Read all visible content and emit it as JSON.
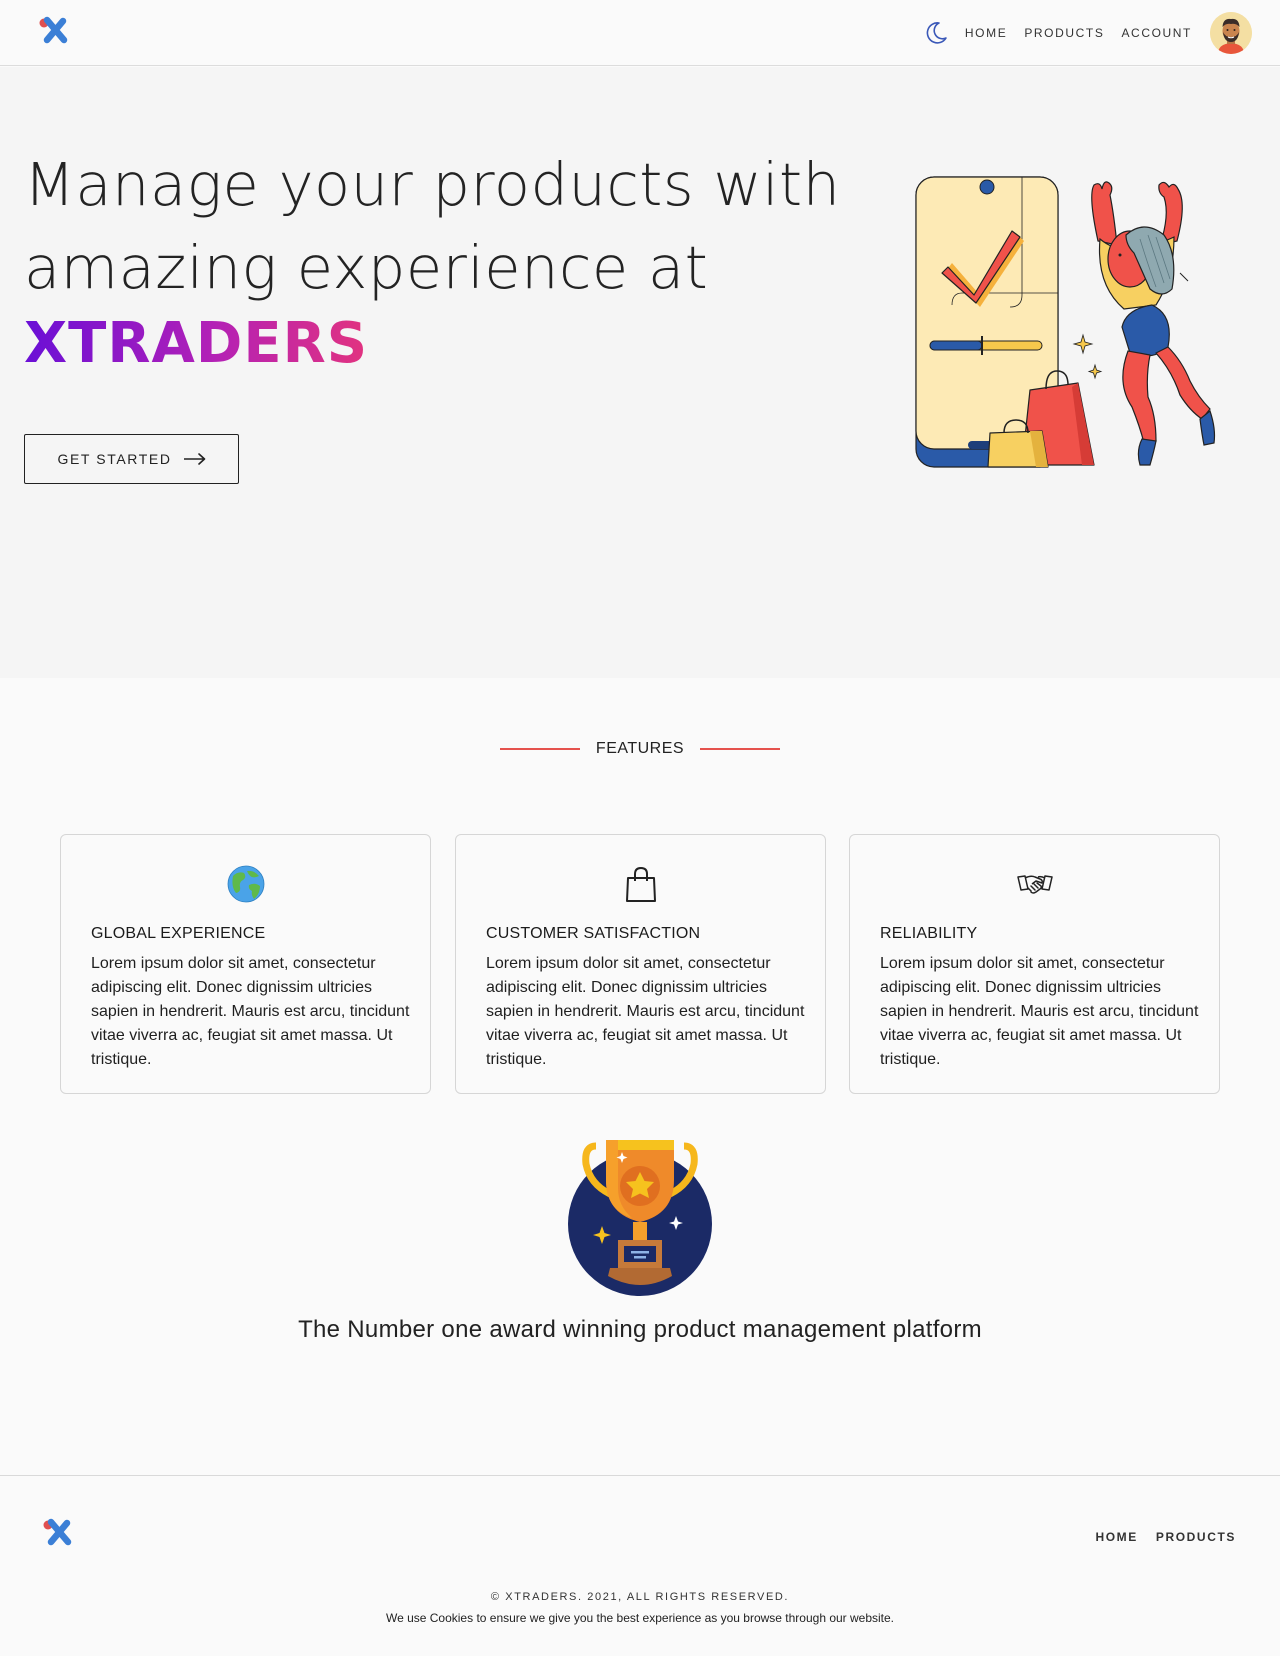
{
  "header": {
    "nav": {
      "home": "HOME",
      "products": "PRODUCTS",
      "account": "ACCOUNT"
    },
    "icons": [
      "logo-icon",
      "moon-icon",
      "avatar"
    ]
  },
  "hero": {
    "line1": "Manage your products with",
    "line2": "amazing experience at",
    "brand": "XTRADERS",
    "cta_label": "GET STARTED"
  },
  "features": {
    "heading": "FEATURES",
    "cards": [
      {
        "icon": "globe-icon",
        "title": "GLOBAL EXPERIENCE",
        "body": "Lorem ipsum dolor sit amet, consectetur adipiscing elit. Donec dignissim ultricies sapien in hendrerit. Mauris est arcu, tincidunt vitae viverra ac, feugiat sit amet massa. Ut tristique."
      },
      {
        "icon": "shopping-bag-icon",
        "title": "CUSTOMER SATISFACTION",
        "body": "Lorem ipsum dolor sit amet, consectetur adipiscing elit. Donec dignissim ultricies sapien in hendrerit. Mauris est arcu, tincidunt vitae viverra ac, feugiat sit amet massa. Ut tristique."
      },
      {
        "icon": "handshake-icon",
        "title": "RELIABILITY",
        "body": "Lorem ipsum dolor sit amet, consectetur adipiscing elit. Donec dignissim ultricies sapien in hendrerit. Mauris est arcu, tincidunt vitae viverra ac, feugiat sit amet massa. Ut tristique."
      }
    ]
  },
  "award": {
    "icon": "trophy-icon",
    "text": "The Number one award winning product management platform"
  },
  "footer": {
    "nav": {
      "home": "HOME",
      "products": "PRODUCTS"
    },
    "copyright": "© XTRADERS. 2021, ALL RIGHTS RESERVED.",
    "cookies": "We use Cookies to ensure we give you the best experience as you browse through our website."
  },
  "colors": {
    "accent_rule": "#e5524d",
    "brand_gradient_start": "#6a0fd6",
    "brand_gradient_end": "#e2337f",
    "logo_blue": "#3b7fd6",
    "logo_red": "#e05050"
  }
}
